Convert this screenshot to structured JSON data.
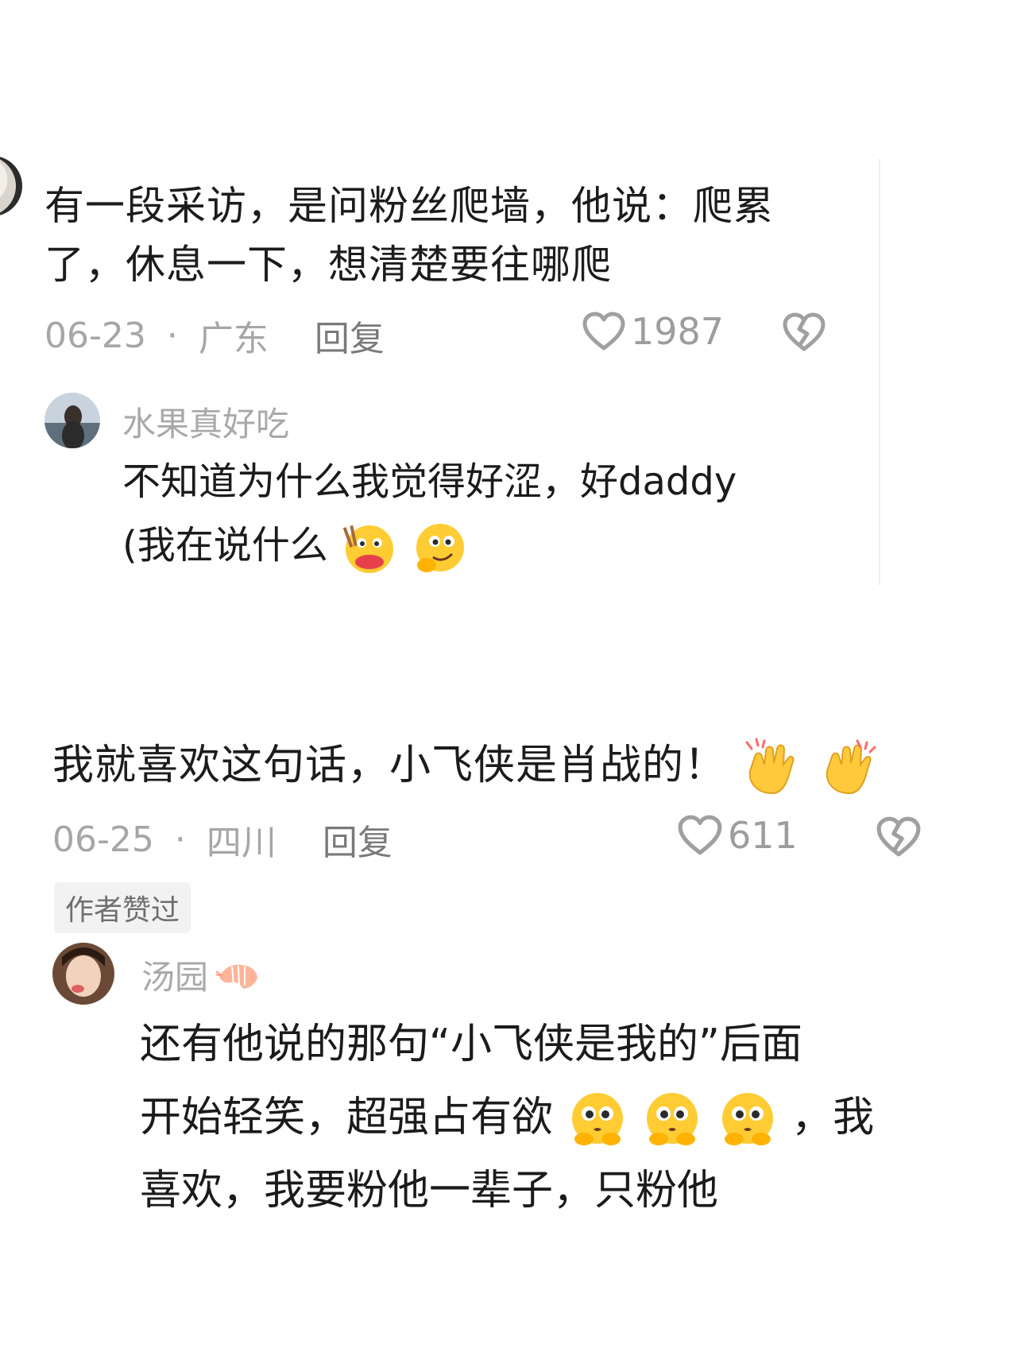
{
  "comment1": {
    "text_line1": "有一段采访，是问粉丝爬墙，他说：爬累",
    "text_line2": "了，休息一下，想清楚要往哪爬",
    "date": "06-23",
    "location": "广东",
    "reply_label": "回复",
    "like_count": "1987",
    "reply": {
      "username": "水果真好吃",
      "text_line1": "不知道为什么我觉得好涩，好daddy",
      "text_line2": "(我在说什么"
    }
  },
  "comment2": {
    "text": "我就喜欢这句话，小飞侠是肖战的！",
    "date": "06-25",
    "location": "四川",
    "reply_label": "回复",
    "like_count": "611",
    "author_badge": "作者赞过",
    "reply": {
      "username": "汤园",
      "text_line1": "还有他说的那句“小飞侠是我的”后面",
      "text_line2_prefix": "开始轻笑，超强占有欲",
      "text_line2_suffix": "，我",
      "text_line3": "喜欢，我要粉他一辈子，只粉他"
    }
  },
  "icons": {
    "like": "heart-outline-icon",
    "dislike": "broken-heart-icon",
    "shrimp": "shrimp-icon",
    "emoji_laugh": "eating-laugh-emoji",
    "emoji_shy": "shy-smile-emoji",
    "emoji_clap": "clapping-hands-emoji",
    "emoji_pleading": "pleading-face-emoji"
  },
  "colors": {
    "text": "#1b1b1b",
    "meta": "#a6a6a6",
    "reply_link": "#7a7a7a",
    "divider": "#efefef",
    "badge_bg": "#f2f2f2"
  }
}
